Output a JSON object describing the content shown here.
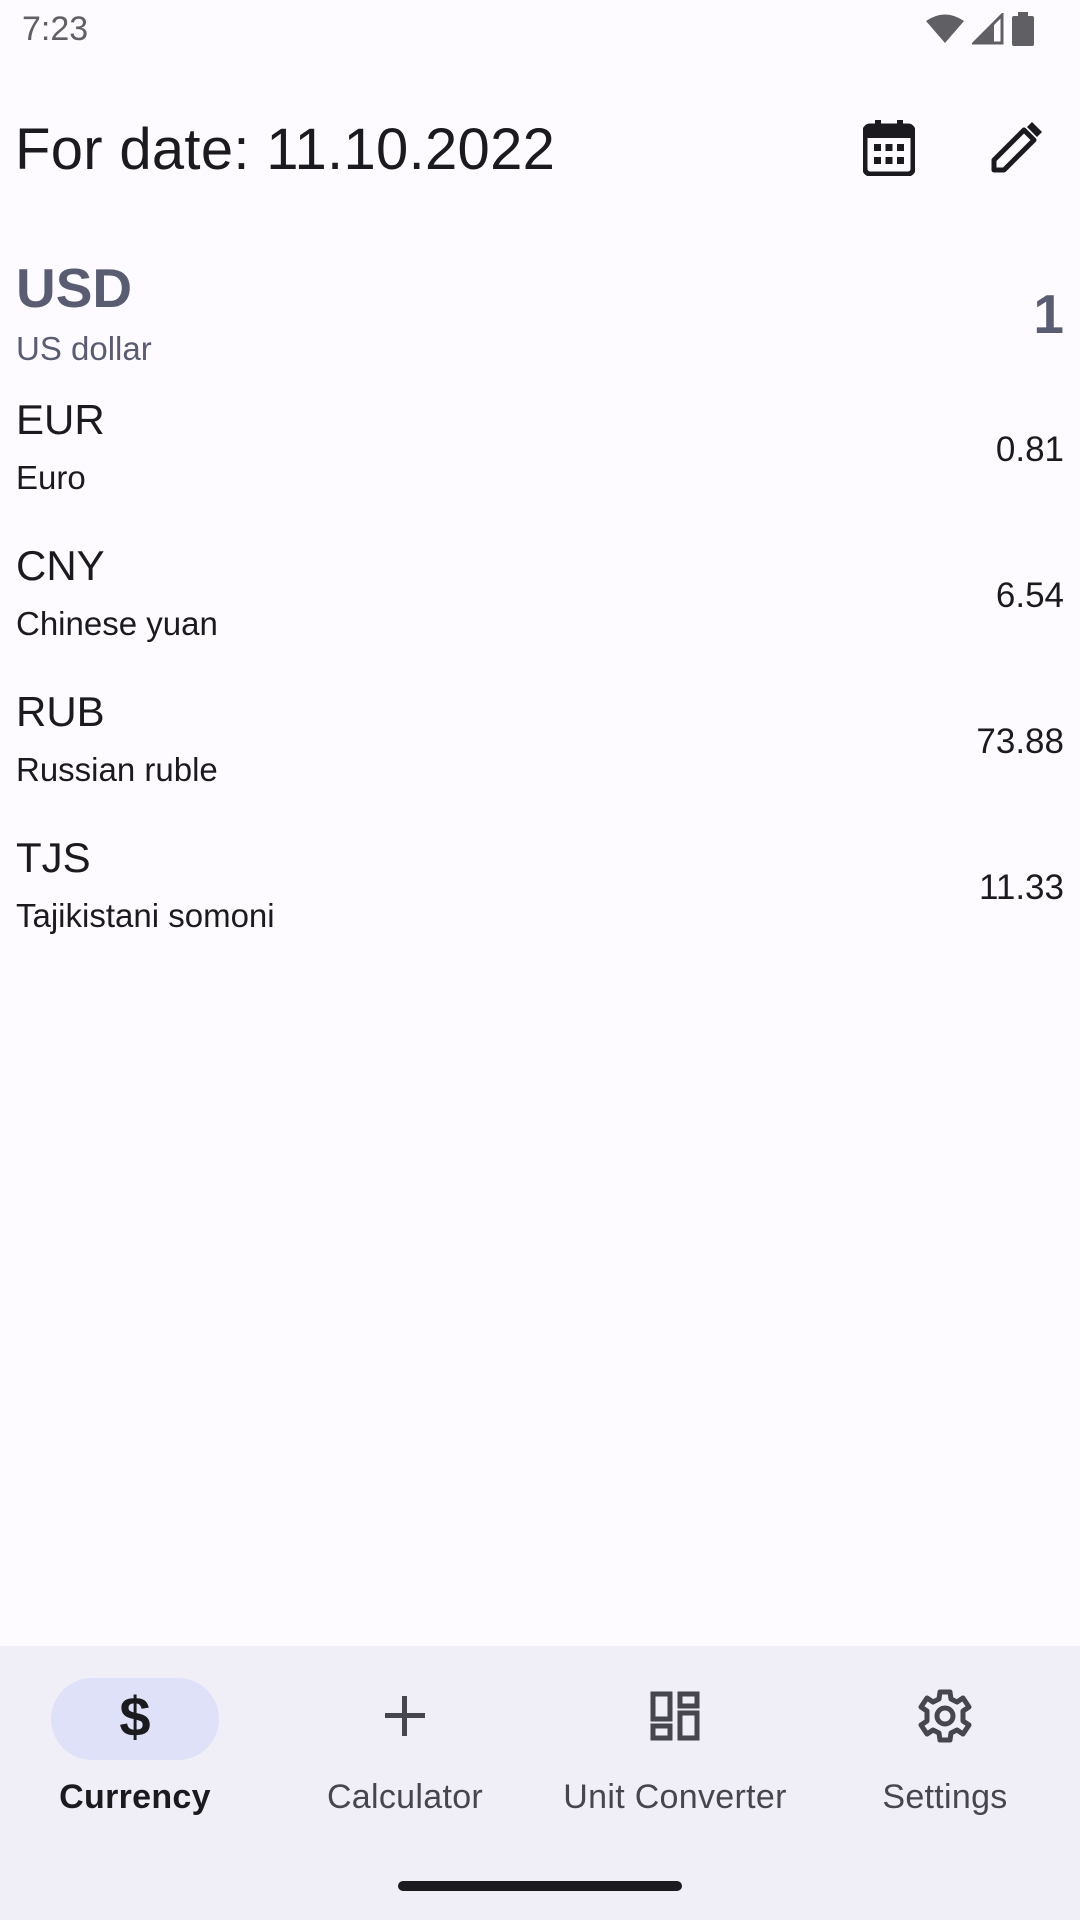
{
  "status_bar": {
    "time": "7:23",
    "icons": [
      "wifi-icon",
      "cell-signal-icon",
      "battery-icon"
    ]
  },
  "app_bar": {
    "title": "For date: 11.10.2022",
    "actions": [
      {
        "name": "calendar-icon"
      },
      {
        "name": "edit-pencil-icon"
      }
    ]
  },
  "currencies": [
    {
      "code": "USD",
      "name": "US dollar",
      "value": "1",
      "base": true
    },
    {
      "code": "EUR",
      "name": "Euro",
      "value": "0.81"
    },
    {
      "code": "CNY",
      "name": "Chinese yuan",
      "value": "6.54"
    },
    {
      "code": "RUB",
      "name": "Russian ruble",
      "value": "73.88"
    },
    {
      "code": "TJS",
      "name": "Tajikistani somoni",
      "value": "11.33"
    }
  ],
  "bottom_nav": {
    "items": [
      {
        "label": "Currency",
        "icon": "dollar-icon",
        "active": true
      },
      {
        "label": "Calculator",
        "icon": "plus-icon",
        "active": false
      },
      {
        "label": "Unit Converter",
        "icon": "dashboard-icon",
        "active": false
      },
      {
        "label": "Settings",
        "icon": "gear-icon",
        "active": false
      }
    ]
  },
  "colors": {
    "background": "#fdfbff",
    "nav_background": "#f0eff7",
    "active_indicator": "#dfe1f9",
    "base_currency_text": "#5a5d72"
  }
}
